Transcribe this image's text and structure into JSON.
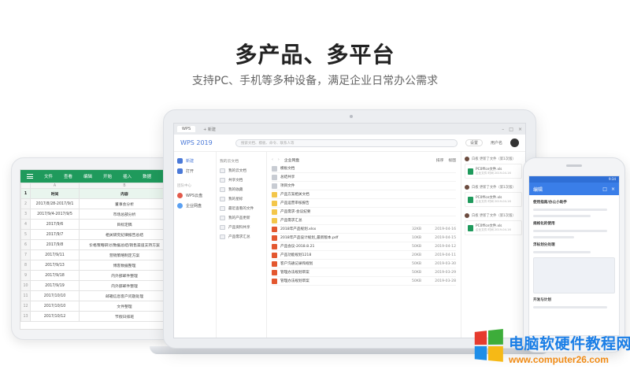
{
  "hero": {
    "title": "多产品、多平台",
    "subtitle": "支持PC、手机等多种设备，满足企业日常办公需求"
  },
  "tablet": {
    "ribbon_tabs": [
      "文件",
      "查看",
      "编辑",
      "开始",
      "插入",
      "数据"
    ],
    "col_letters": [
      "A",
      "B"
    ],
    "header": {
      "time": "时间",
      "content": "内容"
    },
    "rows": [
      {
        "n": "2",
        "time": "2017/8/28-2017/9/1",
        "content": "董事会分析"
      },
      {
        "n": "3",
        "time": "2017/9/4-2017/9/5",
        "content": "市场总部分析"
      },
      {
        "n": "4",
        "time": "2017/9/6",
        "content": "目标定稿"
      },
      {
        "n": "5",
        "time": "2017/9/7",
        "content": "相关研究纪律报告总结"
      },
      {
        "n": "6",
        "time": "2017/9/8",
        "content": "价格策略研讨/数据总结/销售渠道支持方案"
      },
      {
        "n": "7",
        "time": "2017/9/11",
        "content": "营销策略制定方案"
      },
      {
        "n": "8",
        "time": "2017/9/13",
        "content": "博客数据整理"
      },
      {
        "n": "9",
        "time": "2017/9/18",
        "content": "内外部邮件整理"
      },
      {
        "n": "10",
        "time": "2017/9/19",
        "content": "内外部邮件整理"
      },
      {
        "n": "11",
        "time": "2017/10/10",
        "content": "邮箱信息客户问题处理"
      },
      {
        "n": "12",
        "time": "2017/10/10",
        "content": "文件整理"
      },
      {
        "n": "13",
        "time": "2017/10/12",
        "content": "节假日排班"
      }
    ]
  },
  "laptop": {
    "tabs": [
      "WPS",
      "+ 新建"
    ],
    "app_logo": "WPS 2019",
    "search_placeholder": "搜索文档、模板、命令、联系人等",
    "settings_label": "设置",
    "user_name": "用户名",
    "sidebar": {
      "items": [
        {
          "label": "新建",
          "icon": "plus-icon"
        },
        {
          "label": "打开",
          "icon": "folder-icon"
        }
      ],
      "section_label": "团队中心",
      "team_items": [
        {
          "label": "WPS云盘",
          "icon": "cloud-icon"
        },
        {
          "label": "企业网盘",
          "icon": "team-icon"
        }
      ]
    },
    "folders": {
      "title": "我的云文档",
      "items": [
        "我的云文档",
        "共享文档",
        "我的收藏",
        "我的星标",
        "最近查看的文件",
        "我的产品更新",
        "产品资料共享",
        "产品需求汇总"
      ]
    },
    "files_toolbar": {
      "crumb": "企业网盘",
      "actions": [
        "排序",
        "视图"
      ]
    },
    "files": [
      {
        "name": "模板文档",
        "size": "",
        "date": "",
        "icon": "folder"
      },
      {
        "name": "总结共享",
        "size": "",
        "date": "",
        "icon": "folder"
      },
      {
        "name": "项目文件",
        "size": "",
        "date": "",
        "icon": "folder"
      },
      {
        "name": "产品方案相关文档",
        "size": "",
        "date": "",
        "icon": "folder-y"
      },
      {
        "name": "产品运营审核报告",
        "size": "",
        "date": "",
        "icon": "folder-y"
      },
      {
        "name": "产品需求-会议纪要",
        "size": "",
        "date": "",
        "icon": "folder-y"
      },
      {
        "name": "产品需求汇总",
        "size": "",
        "date": "",
        "icon": "folder-y"
      },
      {
        "name": "2018年产品规划.xlsx",
        "size": "32KB",
        "date": "2019-04-16",
        "icon": "doc"
      },
      {
        "name": "2018年产品设计规划_最新版本.pdf",
        "size": "10KB",
        "date": "2019-04-15",
        "icon": "doc"
      },
      {
        "name": "产品会议-2018.8.21",
        "size": "50KB",
        "date": "2019-04-12",
        "icon": "doc"
      },
      {
        "name": "产品功能规划1218",
        "size": "20KB",
        "date": "2019-04-11",
        "icon": "doc"
      },
      {
        "name": "客户沟通记录和规划",
        "size": "50KB",
        "date": "2019-03-30",
        "icon": "doc"
      },
      {
        "name": "管理办法规划草案",
        "size": "50KB",
        "date": "2019-03-29",
        "icon": "doc"
      },
      {
        "name": "管理办法规划草案",
        "size": "50KB",
        "date": "2019-03-28",
        "icon": "doc"
      }
    ],
    "activity": [
      {
        "who": "白板 更新了文件（第1次版）",
        "file": "PC0ffice文件.xls",
        "sub": "企业文件 时间 2019-04-16"
      },
      {
        "who": "白板 更新了文件（第1次版）",
        "file": "PC0ffice文件.xls",
        "sub": "企业文件 时间 2019-04-16"
      },
      {
        "who": "白板 更新了文件（第1次版）",
        "file": "PC0ffice文件.xls",
        "sub": "企业文件 时间 2019-04-16"
      }
    ]
  },
  "phone": {
    "status_time": "9:34",
    "topbar_title": "编辑",
    "headings": [
      "使用指南/办公小助手",
      "规格化的使用",
      "浮标划分处理",
      "开发与计划"
    ]
  },
  "watermark": {
    "title": "电脑软硬件教程网",
    "url": "www.computer26.com",
    "colors": {
      "title": "#1a7ee6",
      "url": "#f08a14"
    }
  },
  "colors": {
    "sheet_accent": "#1f9a5c",
    "wps_blue": "#4a79d8",
    "phone_bar": "#3a7ee8"
  }
}
